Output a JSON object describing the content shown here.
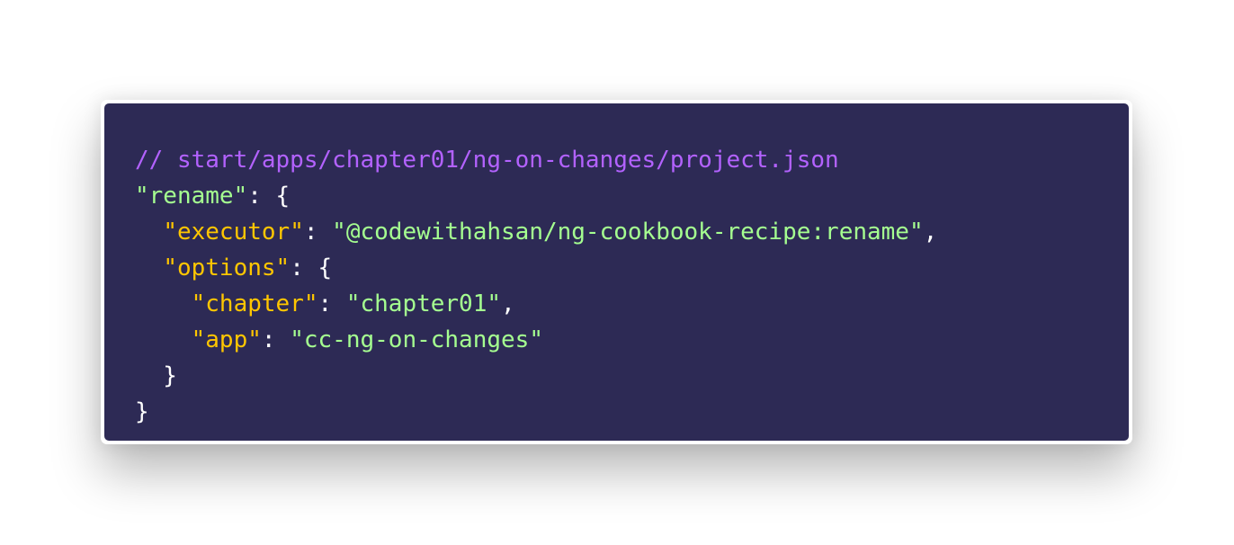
{
  "code": {
    "comment": "// start/apps/chapter01/ng-on-changes/project.json",
    "lines": [
      {
        "key": "rename"
      },
      {
        "key": "executor",
        "value": "@codewithahsan/ng-cookbook-recipe:rename"
      },
      {
        "key": "options"
      },
      {
        "key": "chapter",
        "value": "chapter01"
      },
      {
        "key": "app",
        "value": "cc-ng-on-changes"
      }
    ]
  },
  "colors": {
    "background": "#2d2a55",
    "comment": "#b362ff",
    "key": "#ffc600",
    "string": "#a5ff90",
    "punctuation": "#ffffff"
  }
}
